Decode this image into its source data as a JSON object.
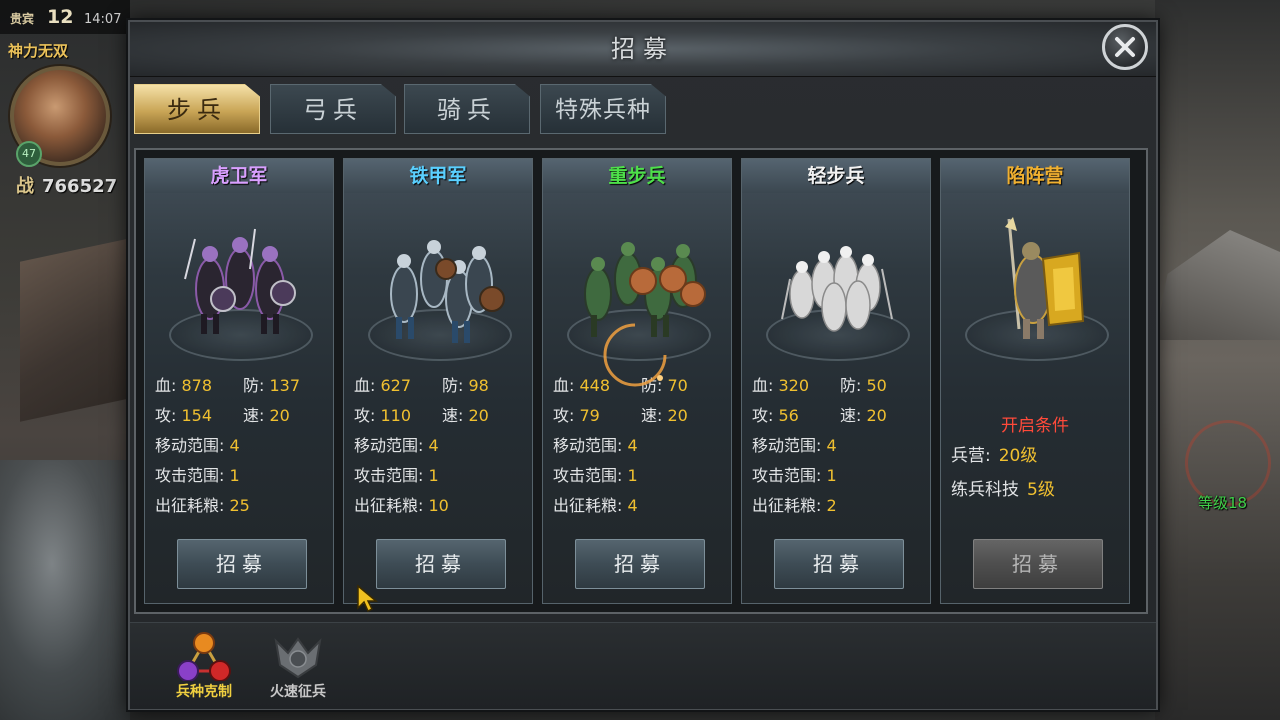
{
  "hud": {
    "vip_label": "贵宾",
    "vip_level": "12",
    "time": "14:07",
    "player_title": "神力无双",
    "avatar_level": "47",
    "power_label": "战",
    "power_value": "766527"
  },
  "map": {
    "building_level": "等级18"
  },
  "dialog": {
    "title": "招募",
    "tabs": [
      {
        "label": "步兵",
        "active": true
      },
      {
        "label": "弓兵",
        "active": false
      },
      {
        "label": "骑兵",
        "active": false
      },
      {
        "label": "特殊兵种",
        "active": false
      }
    ],
    "units": [
      {
        "name": "虎卫军",
        "name_color": "#d9a0ff",
        "hp_label": "血:",
        "hp": "878",
        "def_label": "防:",
        "def": "137",
        "atk_label": "攻:",
        "atk": "154",
        "spd_label": "速:",
        "spd": "20",
        "move_label": "移动范围:",
        "move": "4",
        "range_label": "攻击范围:",
        "range": "1",
        "food_label": "出征耗粮:",
        "food": "25",
        "button": "招募"
      },
      {
        "name": "铁甲军",
        "name_color": "#5ad0ff",
        "hp_label": "血:",
        "hp": "627",
        "def_label": "防:",
        "def": "98",
        "atk_label": "攻:",
        "atk": "110",
        "spd_label": "速:",
        "spd": "20",
        "move_label": "移动范围:",
        "move": "4",
        "range_label": "攻击范围:",
        "range": "1",
        "food_label": "出征耗粮:",
        "food": "10",
        "button": "招募"
      },
      {
        "name": "重步兵",
        "name_color": "#4ee04a",
        "hp_label": "血:",
        "hp": "448",
        "def_label": "防:",
        "def": "70",
        "atk_label": "攻:",
        "atk": "79",
        "spd_label": "速:",
        "spd": "20",
        "move_label": "移动范围:",
        "move": "4",
        "range_label": "攻击范围:",
        "range": "1",
        "food_label": "出征耗粮:",
        "food": "4",
        "button": "招募"
      },
      {
        "name": "轻步兵",
        "name_color": "#f2f2f2",
        "hp_label": "血:",
        "hp": "320",
        "def_label": "防:",
        "def": "50",
        "atk_label": "攻:",
        "atk": "56",
        "spd_label": "速:",
        "spd": "20",
        "move_label": "移动范围:",
        "move": "4",
        "range_label": "攻击范围:",
        "range": "1",
        "food_label": "出征耗粮:",
        "food": "2",
        "button": "招募"
      }
    ],
    "locked_unit": {
      "name": "陷阵营",
      "name_color": "#f0b030",
      "unlock_title": "开启条件",
      "req1_label": "兵营:",
      "req1_value": "20级",
      "req2_label": "练兵科技",
      "req2_value": "5级",
      "button": "招募"
    },
    "bottom": {
      "counter_label": "兵种克制",
      "fast_recruit_label": "火速征兵"
    }
  },
  "icons": [
    "close-icon",
    "troop-counter-icon",
    "fast-recruit-icon",
    "pointer-cursor-icon"
  ]
}
